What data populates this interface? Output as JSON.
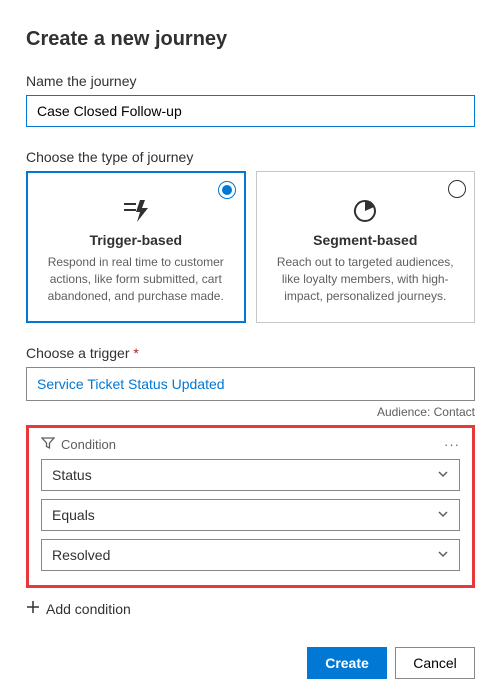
{
  "title": "Create a new journey",
  "name_field": {
    "label": "Name the journey",
    "value": "Case Closed Follow-up"
  },
  "type_section": {
    "label": "Choose the type of journey",
    "options": [
      {
        "title": "Trigger-based",
        "desc": "Respond in real time to customer actions, like form submitted, cart abandoned, and purchase made.",
        "selected": true
      },
      {
        "title": "Segment-based",
        "desc": "Reach out to targeted audiences, like loyalty members, with high-impact, personalized journeys.",
        "selected": false
      }
    ]
  },
  "trigger_section": {
    "label": "Choose a trigger ",
    "required_mark": "*",
    "value": "Service Ticket Status Updated",
    "audience_label": "Audience: Contact"
  },
  "condition": {
    "header": "Condition",
    "field": "Status",
    "operator": "Equals",
    "value": "Resolved"
  },
  "add_condition_label": "Add condition",
  "footer": {
    "create": "Create",
    "cancel": "Cancel"
  }
}
